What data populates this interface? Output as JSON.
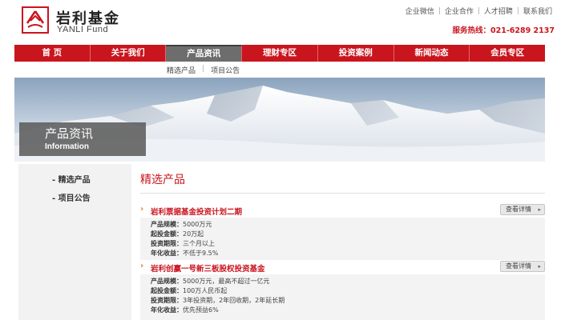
{
  "brand": {
    "name_cn": "岩利基金",
    "name_en": "YANLI Fund",
    "color": "#c9151e"
  },
  "toplinks": [
    "企业微信",
    "企业合作",
    "人才招聘",
    "联系我们"
  ],
  "hotline": "服务热线：021-6289 2137",
  "nav": {
    "items": [
      "首 页",
      "关于我们",
      "产品资讯",
      "理财专区",
      "投资案例",
      "新闻动态",
      "会员专区"
    ],
    "active": "产品资讯"
  },
  "subnav": [
    "精选产品",
    "项目公告"
  ],
  "banner": {
    "title_cn": "产品资讯",
    "title_en": "Information"
  },
  "sidebar": {
    "items": [
      "精选产品",
      "项目公告"
    ]
  },
  "content": {
    "title": "精选产品",
    "detail_label": "查看详情",
    "products": [
      {
        "name": "岩利票据基金投资计划二期",
        "rows": [
          {
            "k": "产品规模：",
            "v": "5000万元"
          },
          {
            "k": "起投金额：",
            "v": "20万起"
          },
          {
            "k": "投资期限：",
            "v": "三个月以上"
          },
          {
            "k": "年化收益：",
            "v": "不低于9.5%"
          }
        ]
      },
      {
        "name": "岩利创赢一号新三板股权投资基金",
        "rows": [
          {
            "k": "产品规模：",
            "v": "5000万元，最高不超过一亿元"
          },
          {
            "k": "起投金额：",
            "v": "100万人民币起"
          },
          {
            "k": "投资期限：",
            "v": "3年投资期，2年回收期，2年延长期"
          },
          {
            "k": "年化收益：",
            "v": "优先预益6%"
          }
        ]
      }
    ]
  }
}
